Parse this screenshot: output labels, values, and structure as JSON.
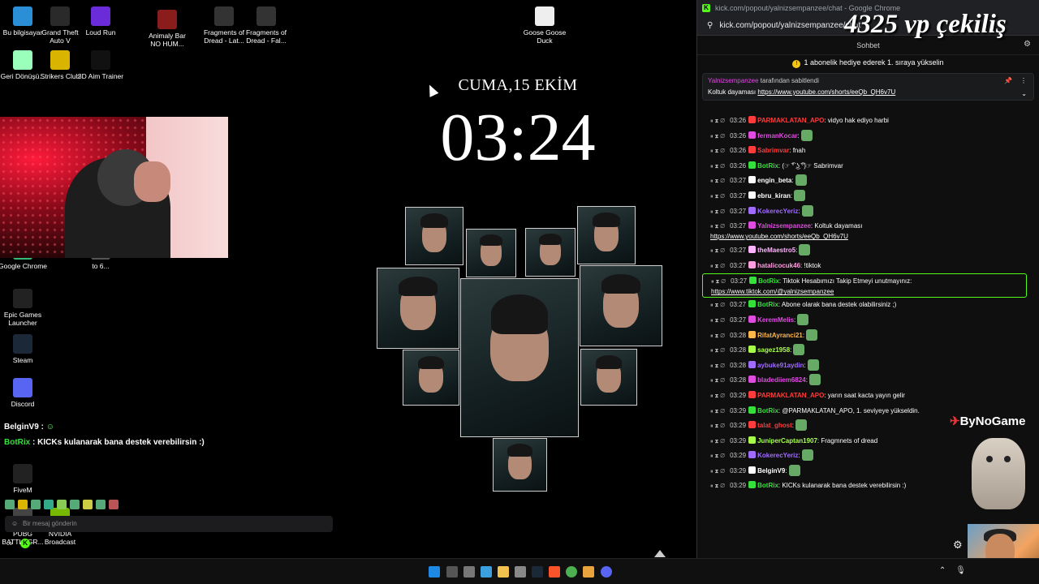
{
  "desktop": {
    "icons": [
      {
        "label": "Bu bilgisayar",
        "icon": "computer-icon",
        "color": "#2b8fd8"
      },
      {
        "label": "Grand Theft Auto V",
        "icon": "gta-icon",
        "color": "#2a2a2a"
      },
      {
        "label": "Loud Run",
        "icon": "loud-run-icon",
        "color": "#6a2bd8"
      },
      {
        "label": "Animaly Bar NO HUM...",
        "icon": "animaly-bar-icon",
        "color": "#8b1c1c"
      },
      {
        "label": "Fragments of Dread - Lat...",
        "icon": "fragments-icon",
        "color": "#333"
      },
      {
        "label": "Fragments of Dread - Fal...",
        "icon": "fragments-icon",
        "color": "#333"
      },
      {
        "label": "Goose Goose Duck",
        "icon": "goose-icon",
        "color": "#eee"
      },
      {
        "label": "Geri Dönüşü...",
        "icon": "recycle-bin-icon",
        "color": "#9fb"
      },
      {
        "label": "Strikers Club",
        "icon": "strikers-icon",
        "color": "#d9b400"
      },
      {
        "label": "3D Aim Trainer",
        "icon": "aim-trainer-icon",
        "color": "#111"
      },
      {
        "label": "Google Chrome",
        "icon": "chrome-icon",
        "color": "#3b7"
      },
      {
        "label": "to 6...",
        "icon": "shortcut-icon",
        "color": "#555"
      },
      {
        "label": "Epic Games Launcher",
        "icon": "epic-games-icon",
        "color": "#222"
      },
      {
        "label": "Steam",
        "icon": "steam-icon",
        "color": "#1b2838"
      },
      {
        "label": "Discord",
        "icon": "discord-icon",
        "color": "#5865f2"
      },
      {
        "label": "FiveM",
        "icon": "fivem-icon",
        "color": "#222"
      },
      {
        "label": "PUBG BATTLEGR...",
        "icon": "pubg-icon",
        "color": "#444"
      },
      {
        "label": "NVIDIA Broadcast",
        "icon": "nvidia-icon",
        "color": "#76b900"
      }
    ]
  },
  "clock": {
    "date": "CUMA,15 EKİM",
    "time": "03:24"
  },
  "overlay": {
    "user": "BelginV9 :",
    "msg_user": "BotRix",
    "msg_text": ": KICKs kulanarak bana destek verebilirsin :)",
    "stream_title": "4325 vp çekiliş",
    "sponsor": "ByNoGame"
  },
  "browser": {
    "title": "kick.com/popout/yalnizsempanzee/chat - Google Chrome",
    "url": "kick.com/popout/yalnizsempanzee/chat",
    "chat_tab": "Sohbet",
    "sub_banner": "1 abonelik hediye ederek 1. sıraya yükselin",
    "pinned_by_user": "Yalnizsempanzee",
    "pinned_by_suffix": "tarafından sabitlendi",
    "pinned_text": "Koltuk dayaması",
    "pinned_link": "https://www.youtube.com/shorts/eeQb_QH6v7U",
    "send_placeholder": "Bir mesaj gönderin"
  },
  "chat": [
    {
      "ts": "03:26",
      "user": "PARMAKLATAN_APO",
      "color": "#ff3b3b",
      "text": ": vidyo hak ediyo harbi"
    },
    {
      "ts": "03:26",
      "user": "fermanKocar",
      "color": "#e04be0",
      "text": ":"
    },
    {
      "ts": "03:26",
      "user": "Sabrimvar",
      "color": "#ff3b3b",
      "text": ": fnah"
    },
    {
      "ts": "03:26",
      "user": "BotRix",
      "color": "#36e03a",
      "text": ": (☞ ͡° ͜ʖ ͡°)☞ Sabrimvar"
    },
    {
      "ts": "03:27",
      "user": "engin_beta",
      "color": "#fff",
      "text": ":"
    },
    {
      "ts": "03:27",
      "user": "ebru_kiran",
      "color": "#fff",
      "text": ":"
    },
    {
      "ts": "03:27",
      "user": "KokerecYeriz",
      "color": "#a06bff",
      "text": ":"
    },
    {
      "ts": "03:27",
      "user": "Yalnizsempanzee",
      "color": "#e04be0",
      "text": ": Koltuk dayaması",
      "link": "https://www.youtube.com/shorts/eeQb_QH6v7U"
    },
    {
      "ts": "03:27",
      "user": "theMaestro5",
      "color": "#ffb3ff",
      "text": ":"
    },
    {
      "ts": "03:27",
      "user": "hatalicocuk46",
      "color": "#ff9de0",
      "text": ": !tiktok"
    },
    {
      "ts": "03:27",
      "user": "BotRix",
      "color": "#36e03a",
      "text": ": Tiktok Hesabımızı Takip Etmeyi unutmayınız:",
      "link": "https://www.tiktok.com/@yalnizsempanzee"
    },
    {
      "ts": "03:27",
      "user": "BotRix",
      "color": "#36e03a",
      "text": ": Abone olarak bana destek olabilirsiniz ;)"
    },
    {
      "ts": "03:27",
      "user": "KeremMelis",
      "color": "#e04be0",
      "text": ":"
    },
    {
      "ts": "03:28",
      "user": "RifatAyranci21",
      "color": "#ffb74a",
      "text": ":"
    },
    {
      "ts": "03:28",
      "user": "sagez1958",
      "color": "#a7ff4a",
      "text": ":"
    },
    {
      "ts": "03:28",
      "user": "aybuke91aydin",
      "color": "#a06bff",
      "text": ":"
    },
    {
      "ts": "03:28",
      "user": "bladediiem6824",
      "color": "#e04be0",
      "text": ":"
    },
    {
      "ts": "03:29",
      "user": "PARMAKLATAN_APO",
      "color": "#ff3b3b",
      "text": ": yarın saat kacta yayın gelir"
    },
    {
      "ts": "03:29",
      "user": "BotRix",
      "color": "#36e03a",
      "text": ": @PARMAKLATAN_APO, 1. seviyeye yükseldin."
    },
    {
      "ts": "03:29",
      "user": "talat_ghost",
      "color": "#ff3b3b",
      "text": ":"
    },
    {
      "ts": "03:29",
      "user": "JuniperCaptan1907",
      "color": "#a7ff4a",
      "text": ": Fragmnets of dread"
    },
    {
      "ts": "03:29",
      "user": "KokerecYeriz",
      "color": "#a06bff",
      "text": ":"
    },
    {
      "ts": "03:29",
      "user": "BelginV9",
      "color": "#fff",
      "text": ":"
    },
    {
      "ts": "03:29",
      "user": "BotRix",
      "color": "#36e03a",
      "text": ": KICKs kulanarak bana destek verebilirsin :)"
    }
  ]
}
